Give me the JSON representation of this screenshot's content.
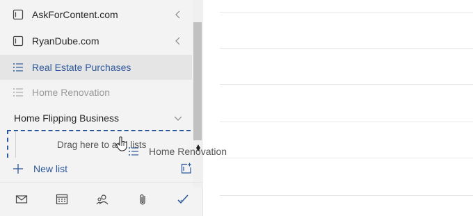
{
  "sidebar": {
    "lists": [
      {
        "label": "AskForContent.com",
        "icon": "group-icon",
        "chevron": "chevron-left-icon"
      },
      {
        "label": "RyanDube.com",
        "icon": "group-icon",
        "chevron": "chevron-left-icon"
      },
      {
        "label": "Real Estate Purchases",
        "icon": "list-icon",
        "selected": true
      },
      {
        "label": "Home Renovation",
        "icon": "list-icon",
        "dim": true
      }
    ],
    "group": {
      "label": "Home Flipping Business",
      "chevron": "chevron-down-icon"
    },
    "dropzone": {
      "text": "Drag here to add lists"
    },
    "new_list": {
      "label": "New list"
    },
    "nav": [
      "mail-icon",
      "calendar-icon",
      "people-icon",
      "attachment-icon",
      "todo-check-icon"
    ]
  },
  "drag_ghost": {
    "label": "Home Renovation"
  },
  "colors": {
    "accent": "#2b579a",
    "sidebar_bg": "#f3f3f3",
    "selected_bg": "#e5e5e5"
  }
}
